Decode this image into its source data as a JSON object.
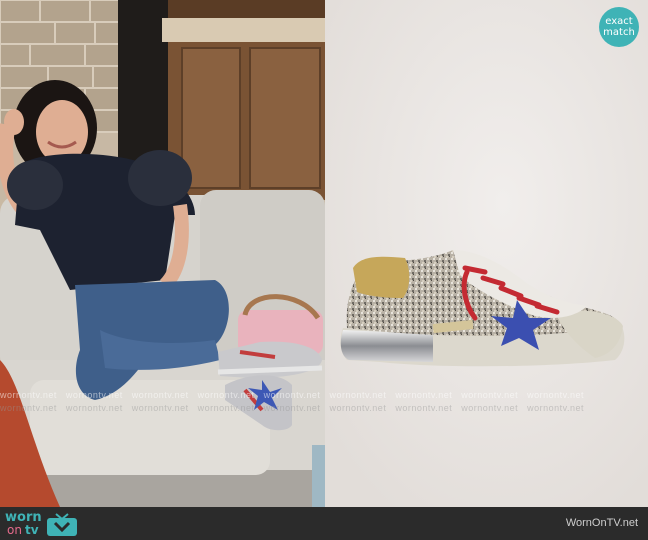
{
  "badge": {
    "line1": "exact",
    "line2": "match"
  },
  "watermark": {
    "text": "wornontv.net"
  },
  "footer": {
    "logo_worn": "worn",
    "logo_on": "on",
    "logo_tv": "tv",
    "site": "WornOnTV.net"
  },
  "colors": {
    "accent": "#3fb3b6",
    "logo_pink": "#e46a8b",
    "footer_bg": "#2b2b2b"
  }
}
